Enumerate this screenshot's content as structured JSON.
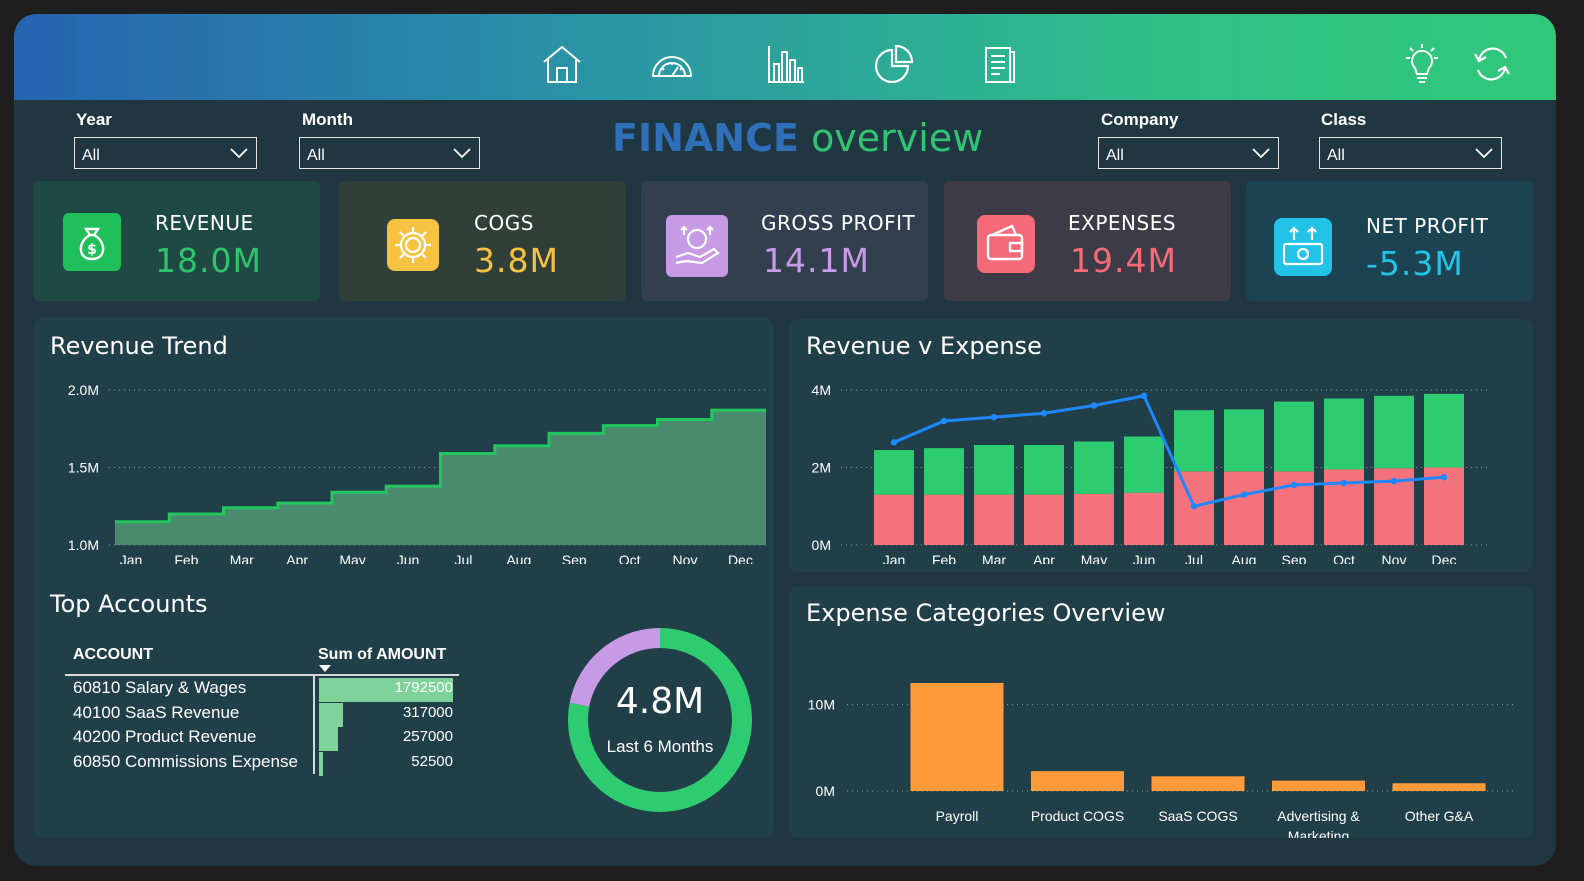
{
  "nav": {
    "icons": [
      "home-icon",
      "speedometer-icon",
      "bar-chart-icon",
      "pie-chart-icon",
      "report-icon"
    ],
    "right_icons": [
      "lightbulb-icon",
      "refresh-icon"
    ]
  },
  "filters": {
    "year": {
      "label": "Year",
      "value": "All"
    },
    "month": {
      "label": "Month",
      "value": "All"
    },
    "company": {
      "label": "Company",
      "value": "All"
    },
    "class": {
      "label": "Class",
      "value": "All"
    }
  },
  "title": {
    "part1": "FINANCE",
    "part2": "overview"
  },
  "kpis": {
    "revenue": {
      "label": "REVENUE",
      "value": "18.0M",
      "color": "#2fc36a"
    },
    "cogs": {
      "label": "COGS",
      "value": "3.8M",
      "color": "#f5c242"
    },
    "gross_profit": {
      "label": "GROSS PROFIT",
      "value": "14.1M",
      "color": "#c99ae8"
    },
    "expenses": {
      "label": "EXPENSES",
      "value": "19.4M",
      "color": "#f46a78"
    },
    "net_profit": {
      "label": "NET PROFIT",
      "value": "-5.3M",
      "color": "#22c3e6"
    }
  },
  "revenue_trend": {
    "title": "Revenue Trend"
  },
  "revenue_v_expense": {
    "title": "Revenue v Expense"
  },
  "top_accounts": {
    "title": "Top Accounts",
    "col_account": "ACCOUNT",
    "col_amount": "Sum of AMOUNT",
    "rows": [
      {
        "account": "60810 Salary & Wages",
        "amount": "1792500"
      },
      {
        "account": "40100 SaaS Revenue",
        "amount": "317000"
      },
      {
        "account": "40200 Product Revenue",
        "amount": "257000"
      },
      {
        "account": "60850 Commissions Expense",
        "amount": "52500"
      }
    ]
  },
  "donut": {
    "value": "4.8M",
    "label": "Last 6 Months"
  },
  "expense_categories": {
    "title": "Expense Categories Overview"
  },
  "chart_data": [
    {
      "type": "area",
      "title": "Revenue Trend",
      "categories": [
        "Jan",
        "Feb",
        "Mar",
        "Apr",
        "May",
        "Jun",
        "Jul",
        "Aug",
        "Sep",
        "Oct",
        "Nov",
        "Dec"
      ],
      "values": [
        1.15,
        1.2,
        1.24,
        1.27,
        1.34,
        1.38,
        1.59,
        1.64,
        1.72,
        1.77,
        1.81,
        1.87
      ],
      "ylim": [
        1.0,
        2.0
      ],
      "yticks": [
        "1.0M",
        "1.5M",
        "2.0M"
      ],
      "colors": {
        "fill": "#4a8a6e",
        "line": "#22c55e"
      }
    },
    {
      "type": "bar",
      "title": "Revenue v Expense",
      "categories": [
        "Jan",
        "Feb",
        "Mar",
        "Apr",
        "May",
        "Jun",
        "Jul",
        "Aug",
        "Sep",
        "Oct",
        "Nov",
        "Dec"
      ],
      "series": [
        {
          "values": [
            1.3,
            1.3,
            1.3,
            1.3,
            1.32,
            1.35,
            1.9,
            1.9,
            1.9,
            1.95,
            1.98,
            2.0
          ],
          "color": "#f4727c"
        },
        {
          "values": [
            1.15,
            1.2,
            1.28,
            1.28,
            1.35,
            1.45,
            1.58,
            1.6,
            1.8,
            1.83,
            1.87,
            1.9
          ],
          "color": "#2ecc71"
        },
        {
          "values": [
            2.65,
            3.2,
            3.3,
            3.4,
            3.6,
            3.85,
            1.0,
            1.3,
            1.55,
            1.6,
            1.65,
            1.75
          ],
          "color": "#1e88ff",
          "type": "line"
        }
      ],
      "ylim": [
        0,
        4
      ],
      "yticks": [
        "0M",
        "2M",
        "4M"
      ]
    },
    {
      "type": "pie",
      "center_value": "4.8M",
      "center_label": "Last 6 Months",
      "slices": [
        {
          "value": 0.78,
          "color": "#2ecc71"
        },
        {
          "value": 0.22,
          "color": "#c79ae6"
        }
      ]
    },
    {
      "type": "bar",
      "title": "Expense Categories Overview",
      "categories": [
        "Payroll",
        "Product COGS",
        "SaaS COGS",
        "Advertising & Marketing",
        "Other G&A"
      ],
      "values": [
        12.5,
        2.3,
        1.7,
        1.2,
        0.9
      ],
      "ylim": [
        0,
        12.5
      ],
      "yticks": [
        "0M",
        "10M"
      ],
      "colors": {
        "bar": "#ff9b3a"
      }
    }
  ]
}
